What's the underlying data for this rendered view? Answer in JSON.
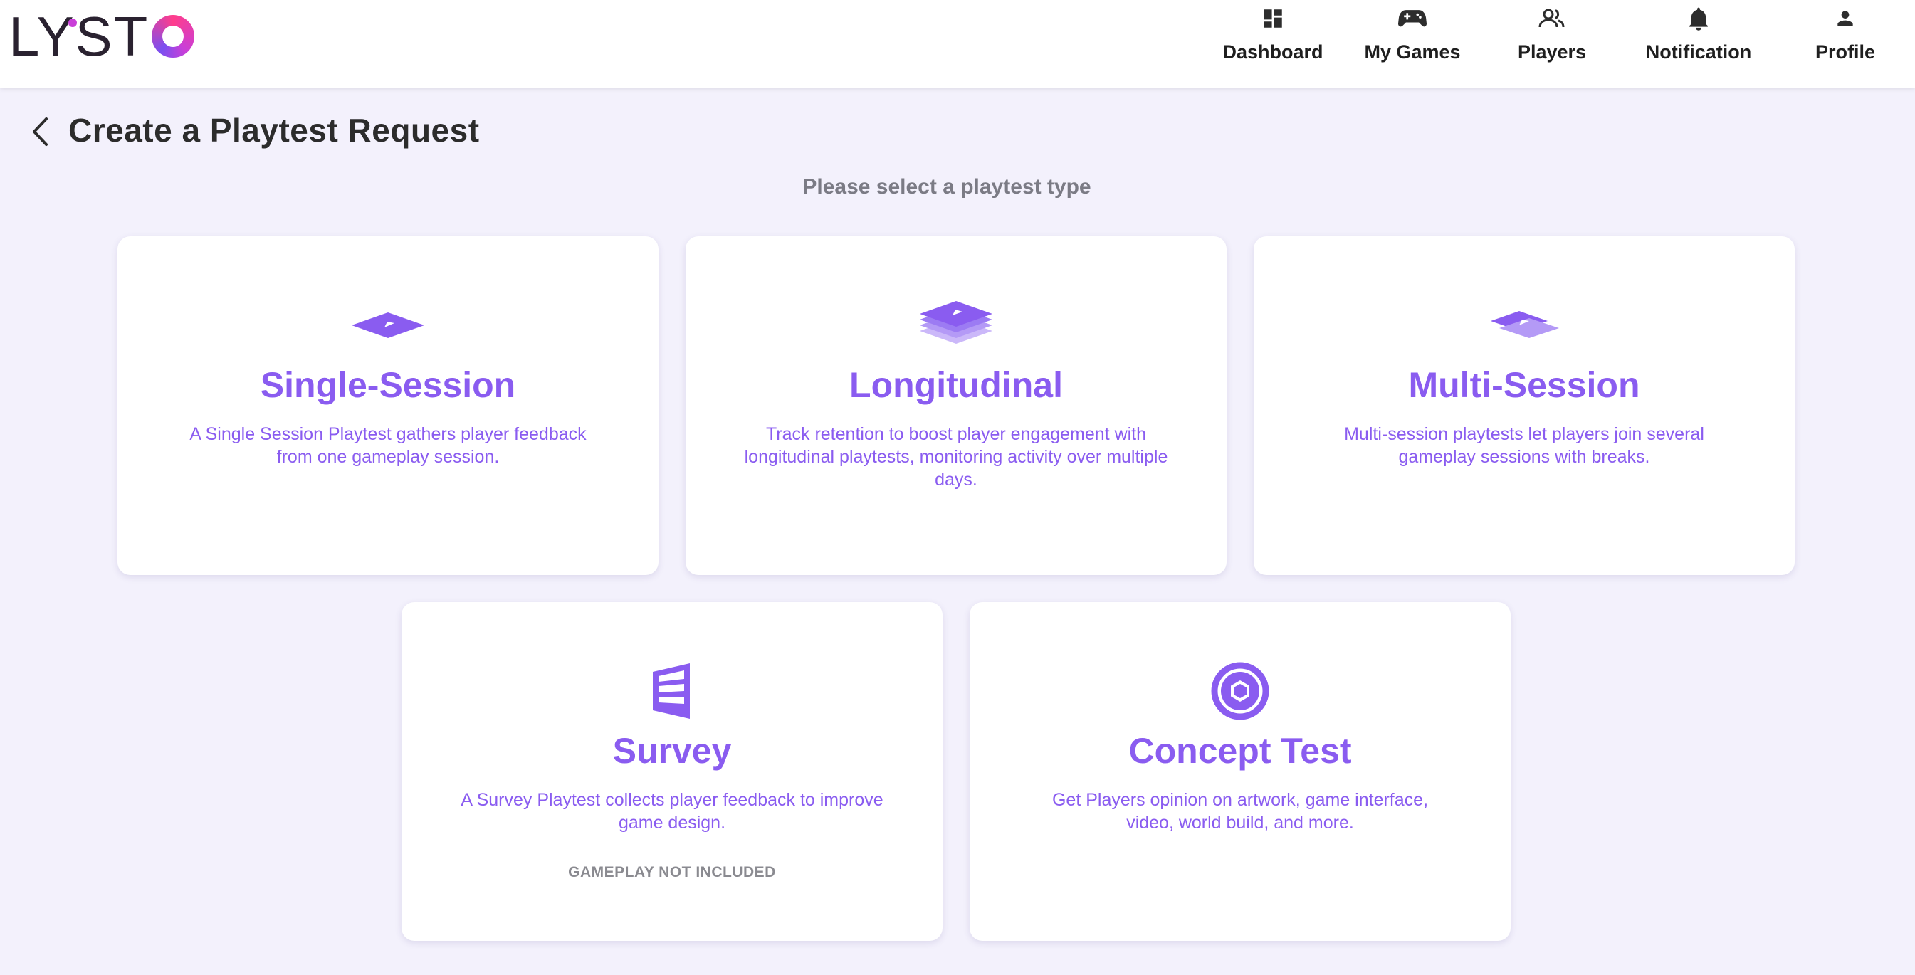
{
  "app": {
    "logo_text": "LYST",
    "brand_color": "#8a5cf0"
  },
  "nav": {
    "items": [
      {
        "label": "Dashboard",
        "icon": "dashboard-icon"
      },
      {
        "label": "My Games",
        "icon": "gamepad-icon"
      },
      {
        "label": "Players",
        "icon": "players-icon"
      },
      {
        "label": "Notification",
        "icon": "bell-icon"
      },
      {
        "label": "Profile",
        "icon": "person-icon"
      }
    ]
  },
  "header": {
    "title": "Create a Playtest Request",
    "subtitle": "Please select a playtest type"
  },
  "cards": [
    {
      "title": "Single-Session",
      "description": "A Single Session Playtest gathers player feedback from one gameplay session.",
      "icon": "single-layer-icon"
    },
    {
      "title": "Longitudinal",
      "description": "Track retention to boost player engagement with longitudinal playtests, monitoring activity over multiple days.",
      "icon": "stacked-layers-icon"
    },
    {
      "title": "Multi-Session",
      "description": "Multi-session playtests let players join several gameplay sessions with breaks.",
      "icon": "split-layers-icon"
    },
    {
      "title": "Survey",
      "description": "A Survey Playtest collects player feedback to improve game design.",
      "note": "GAMEPLAY NOT INCLUDED",
      "icon": "survey-icon"
    },
    {
      "title": "Concept Test",
      "description": "Get Players opinion on artwork, game interface, video, world build, and more.",
      "icon": "hexagon-circle-icon"
    }
  ]
}
